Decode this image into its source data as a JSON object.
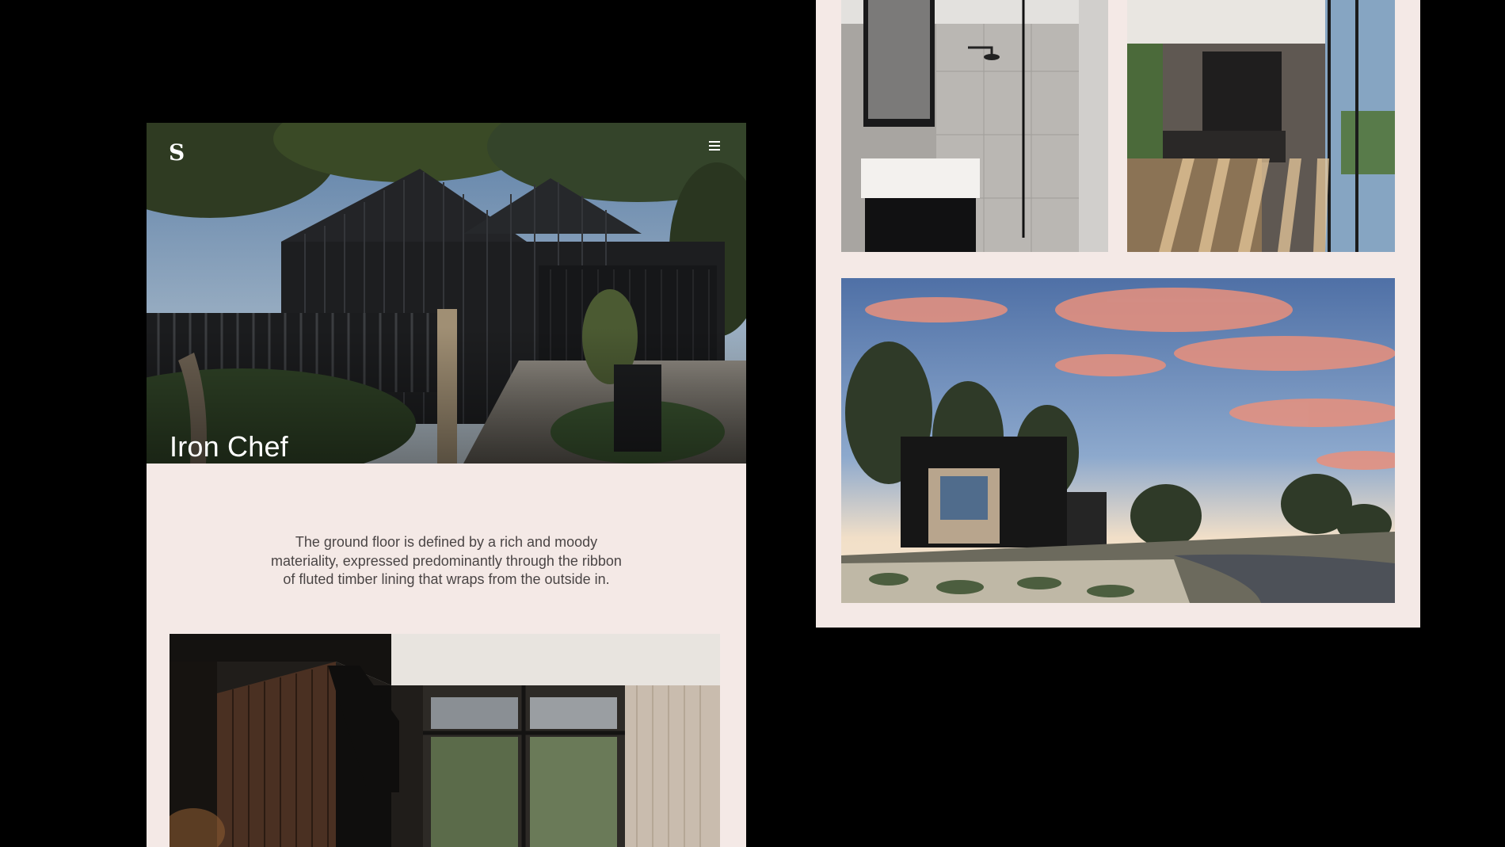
{
  "left_page": {
    "logo_text": "S",
    "menu_icon": "hamburger-menu-icon",
    "hero": {
      "title": "Iron Chef",
      "image": "house-exterior-photo"
    },
    "description": "The ground floor is defined by a rich and moody materiality, expressed predominantly through the ribbon of fluted timber lining that wraps from the outside in.",
    "interior_image": "interior-living-photo"
  },
  "right_page": {
    "images": [
      "bathroom-photo",
      "hallway-photo",
      "cabin-sunset-photo"
    ]
  },
  "colors": {
    "background": "#000000",
    "page_background": "#f4e9e6",
    "text": "#4a4545",
    "hero_text": "#ffffff"
  }
}
